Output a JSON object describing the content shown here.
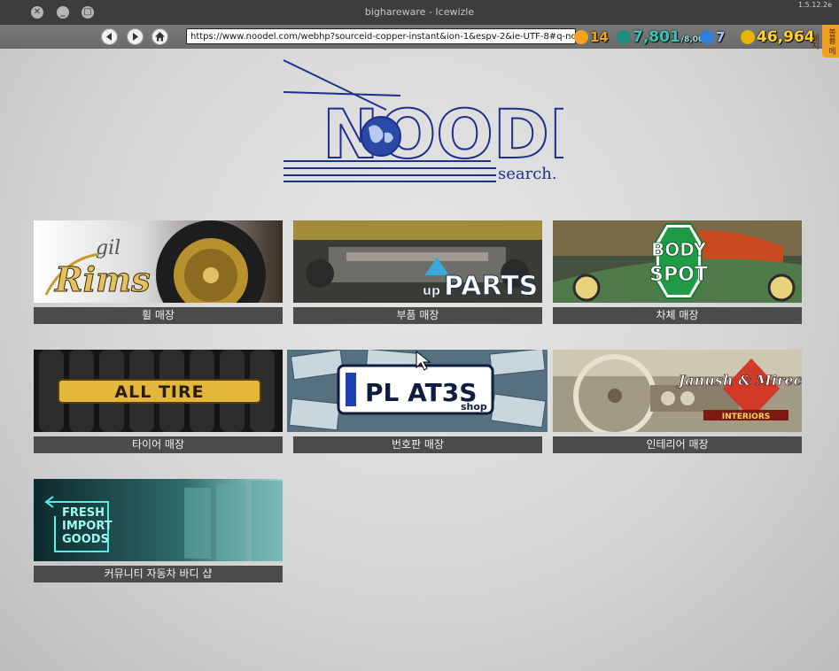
{
  "window": {
    "title": "bighareware - Icewizle",
    "version": "1.5.12.2e"
  },
  "browser": {
    "url": "https://www.noodel.com/webhp?sourceid-copper-instant&ion-1&espv-2&ie-UTF-8#q-noodel"
  },
  "hud": {
    "level": "14",
    "energy": "7,801",
    "energy_max": "/8,000",
    "stars": "7",
    "money": "46,964"
  },
  "side_tab": "볼륨 메세지",
  "logo": {
    "main": "NOODEL",
    "sub": "search."
  },
  "tiles": [
    {
      "label": "휠 매장",
      "banner_text": "Rims",
      "banner_small": "gil"
    },
    {
      "label": "부품 매장",
      "banner_text": "PARTS",
      "banner_small": "up"
    },
    {
      "label": "차체 매장",
      "banner_text": "BODY",
      "banner_small": "SPOT"
    },
    {
      "label": "타이어 매장",
      "banner_text": "ALL TIRE"
    },
    {
      "label": "번호판 매장",
      "banner_text": "PL AT3S",
      "banner_small": "shop"
    },
    {
      "label": "인테리어 매장",
      "banner_text": "Janush & Mireck's",
      "banner_small": "INTERIORS"
    },
    {
      "label": "커뮤니티 자동차 바디 샵",
      "banner_text": "FRESH IMPORT GOODS"
    }
  ],
  "colors": {
    "logo_blue": "#1f2f8c",
    "label_bg": "#4b4b4b",
    "titlebar_bg": "#3d3d3d"
  }
}
